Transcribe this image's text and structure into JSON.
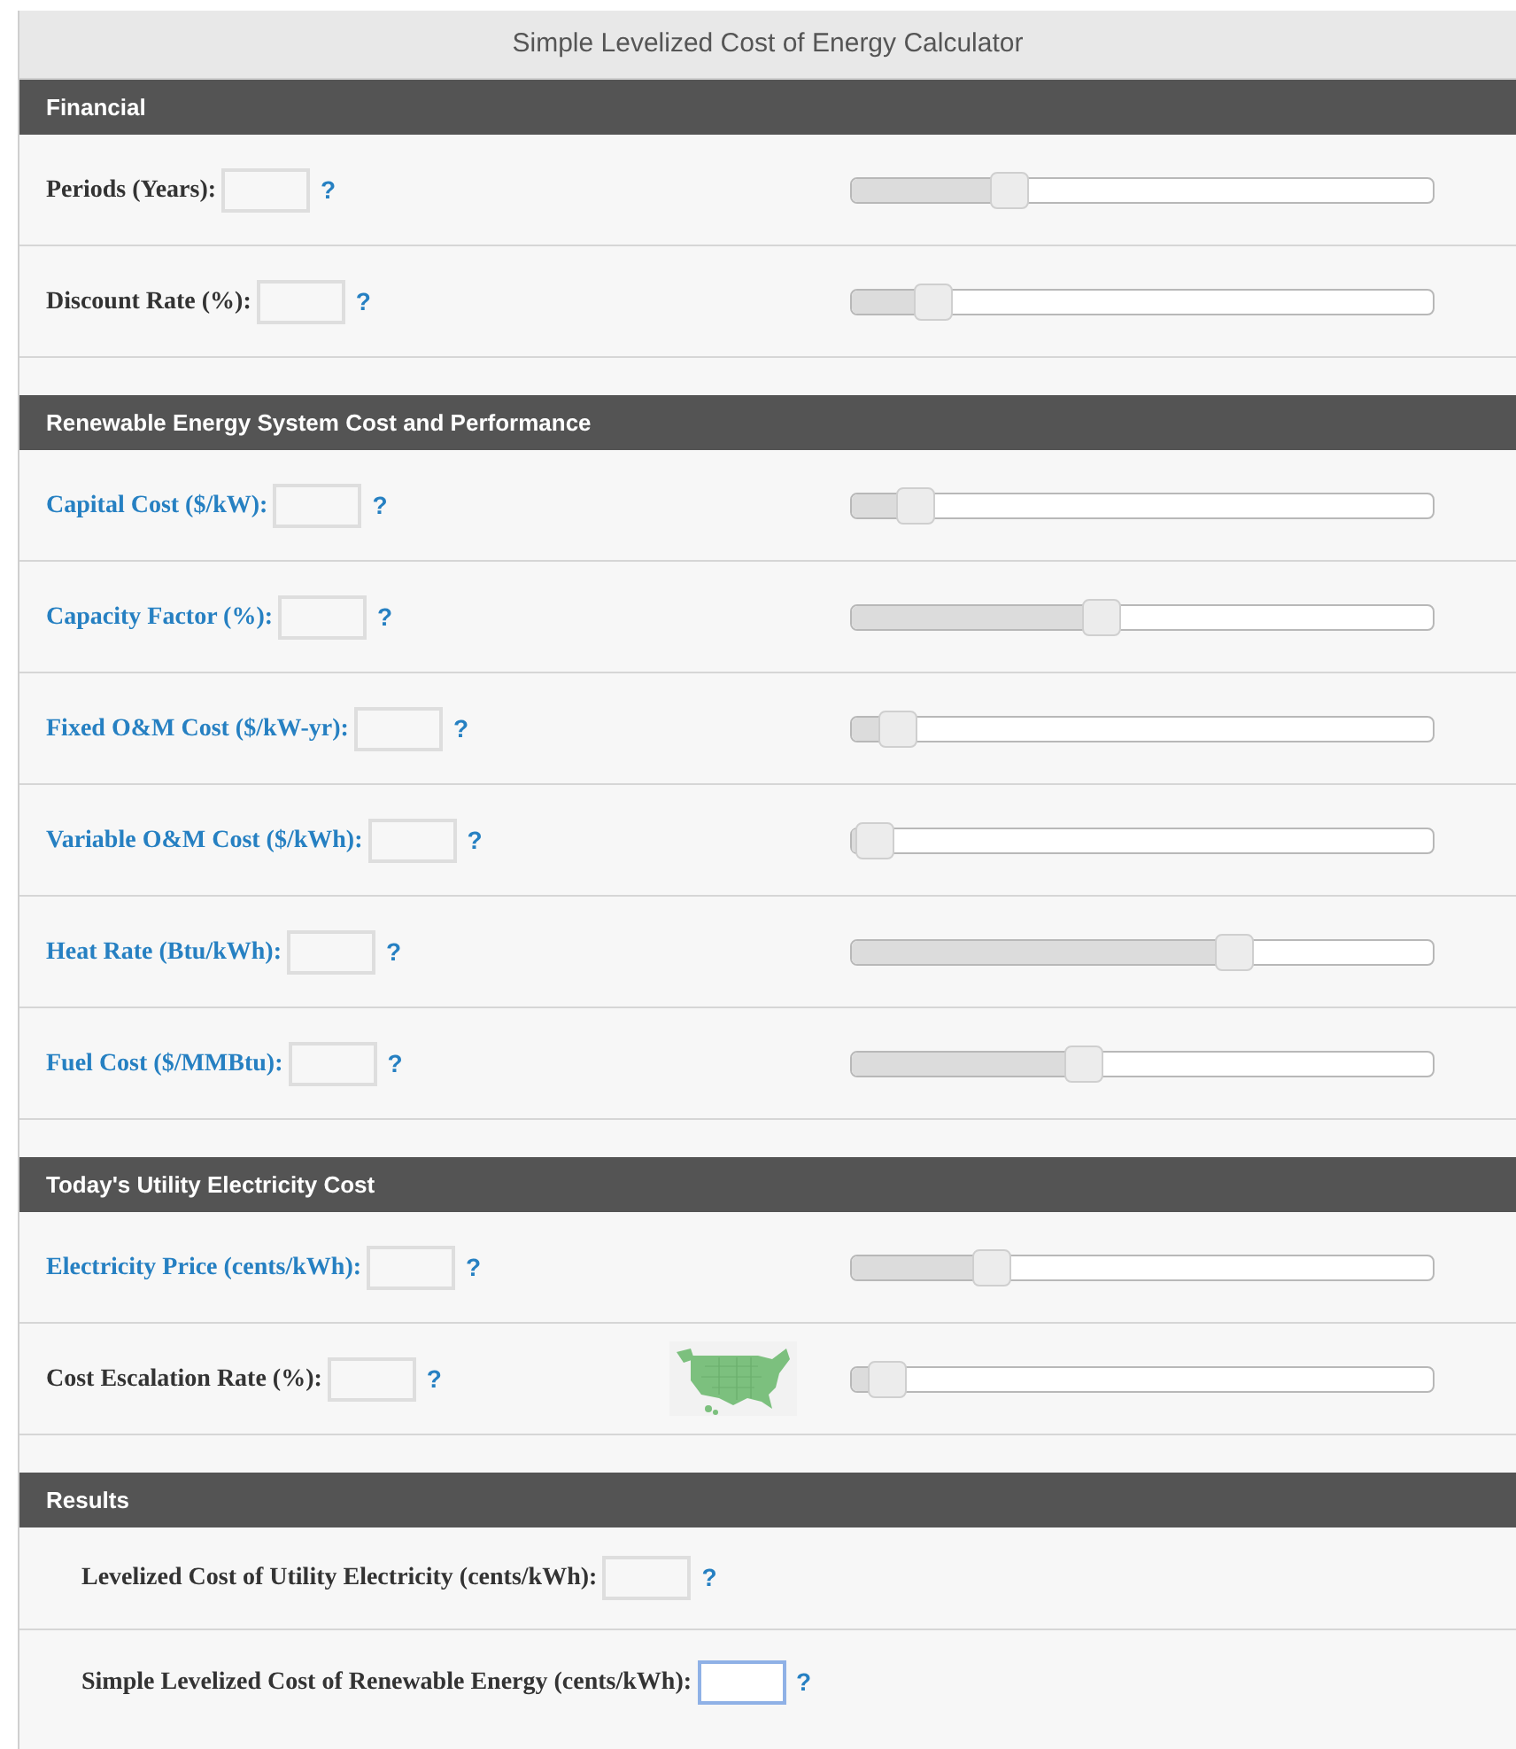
{
  "title": "Simple Levelized Cost of Energy Calculator",
  "sections": [
    {
      "heading": "Financial",
      "rows": [
        {
          "label": "Periods (Years):",
          "linked": false,
          "help": "?",
          "level": 0.27
        },
        {
          "label": "Discount Rate (%):",
          "linked": false,
          "help": "?",
          "level": 0.14
        }
      ]
    },
    {
      "heading": "Renewable Energy System Cost and Performance",
      "rows": [
        {
          "label": "Capital Cost ($/kW):",
          "linked": true,
          "help": "?",
          "level": 0.11
        },
        {
          "label": "Capacity Factor (%):",
          "linked": true,
          "help": "?",
          "level": 0.43
        },
        {
          "label": "Fixed O&M Cost ($/kW-yr):",
          "linked": true,
          "help": "?",
          "level": 0.08
        },
        {
          "label": "Variable O&M Cost ($/kWh):",
          "linked": true,
          "help": "?",
          "level": 0.04
        },
        {
          "label": "Heat Rate (Btu/kWh):",
          "linked": true,
          "help": "?",
          "level": 0.66
        },
        {
          "label": "Fuel Cost ($/MMBtu):",
          "linked": true,
          "help": "?",
          "level": 0.4
        }
      ]
    },
    {
      "heading": "Today's Utility Electricity Cost",
      "rows": [
        {
          "label": "Electricity Price (cents/kWh):",
          "linked": true,
          "help": "?",
          "level": 0.24
        },
        {
          "label": "Cost Escalation Rate (%):",
          "linked": false,
          "help": "?",
          "level": 0.06
        }
      ]
    }
  ],
  "results": {
    "heading": "Results",
    "rows": [
      {
        "label": "Levelized Cost of Utility Electricity (cents/kWh):",
        "help": "?",
        "focused": false
      },
      {
        "label": "Simple Levelized Cost of Renewable Energy (cents/kWh):",
        "help": "?",
        "focused": true
      }
    ]
  }
}
